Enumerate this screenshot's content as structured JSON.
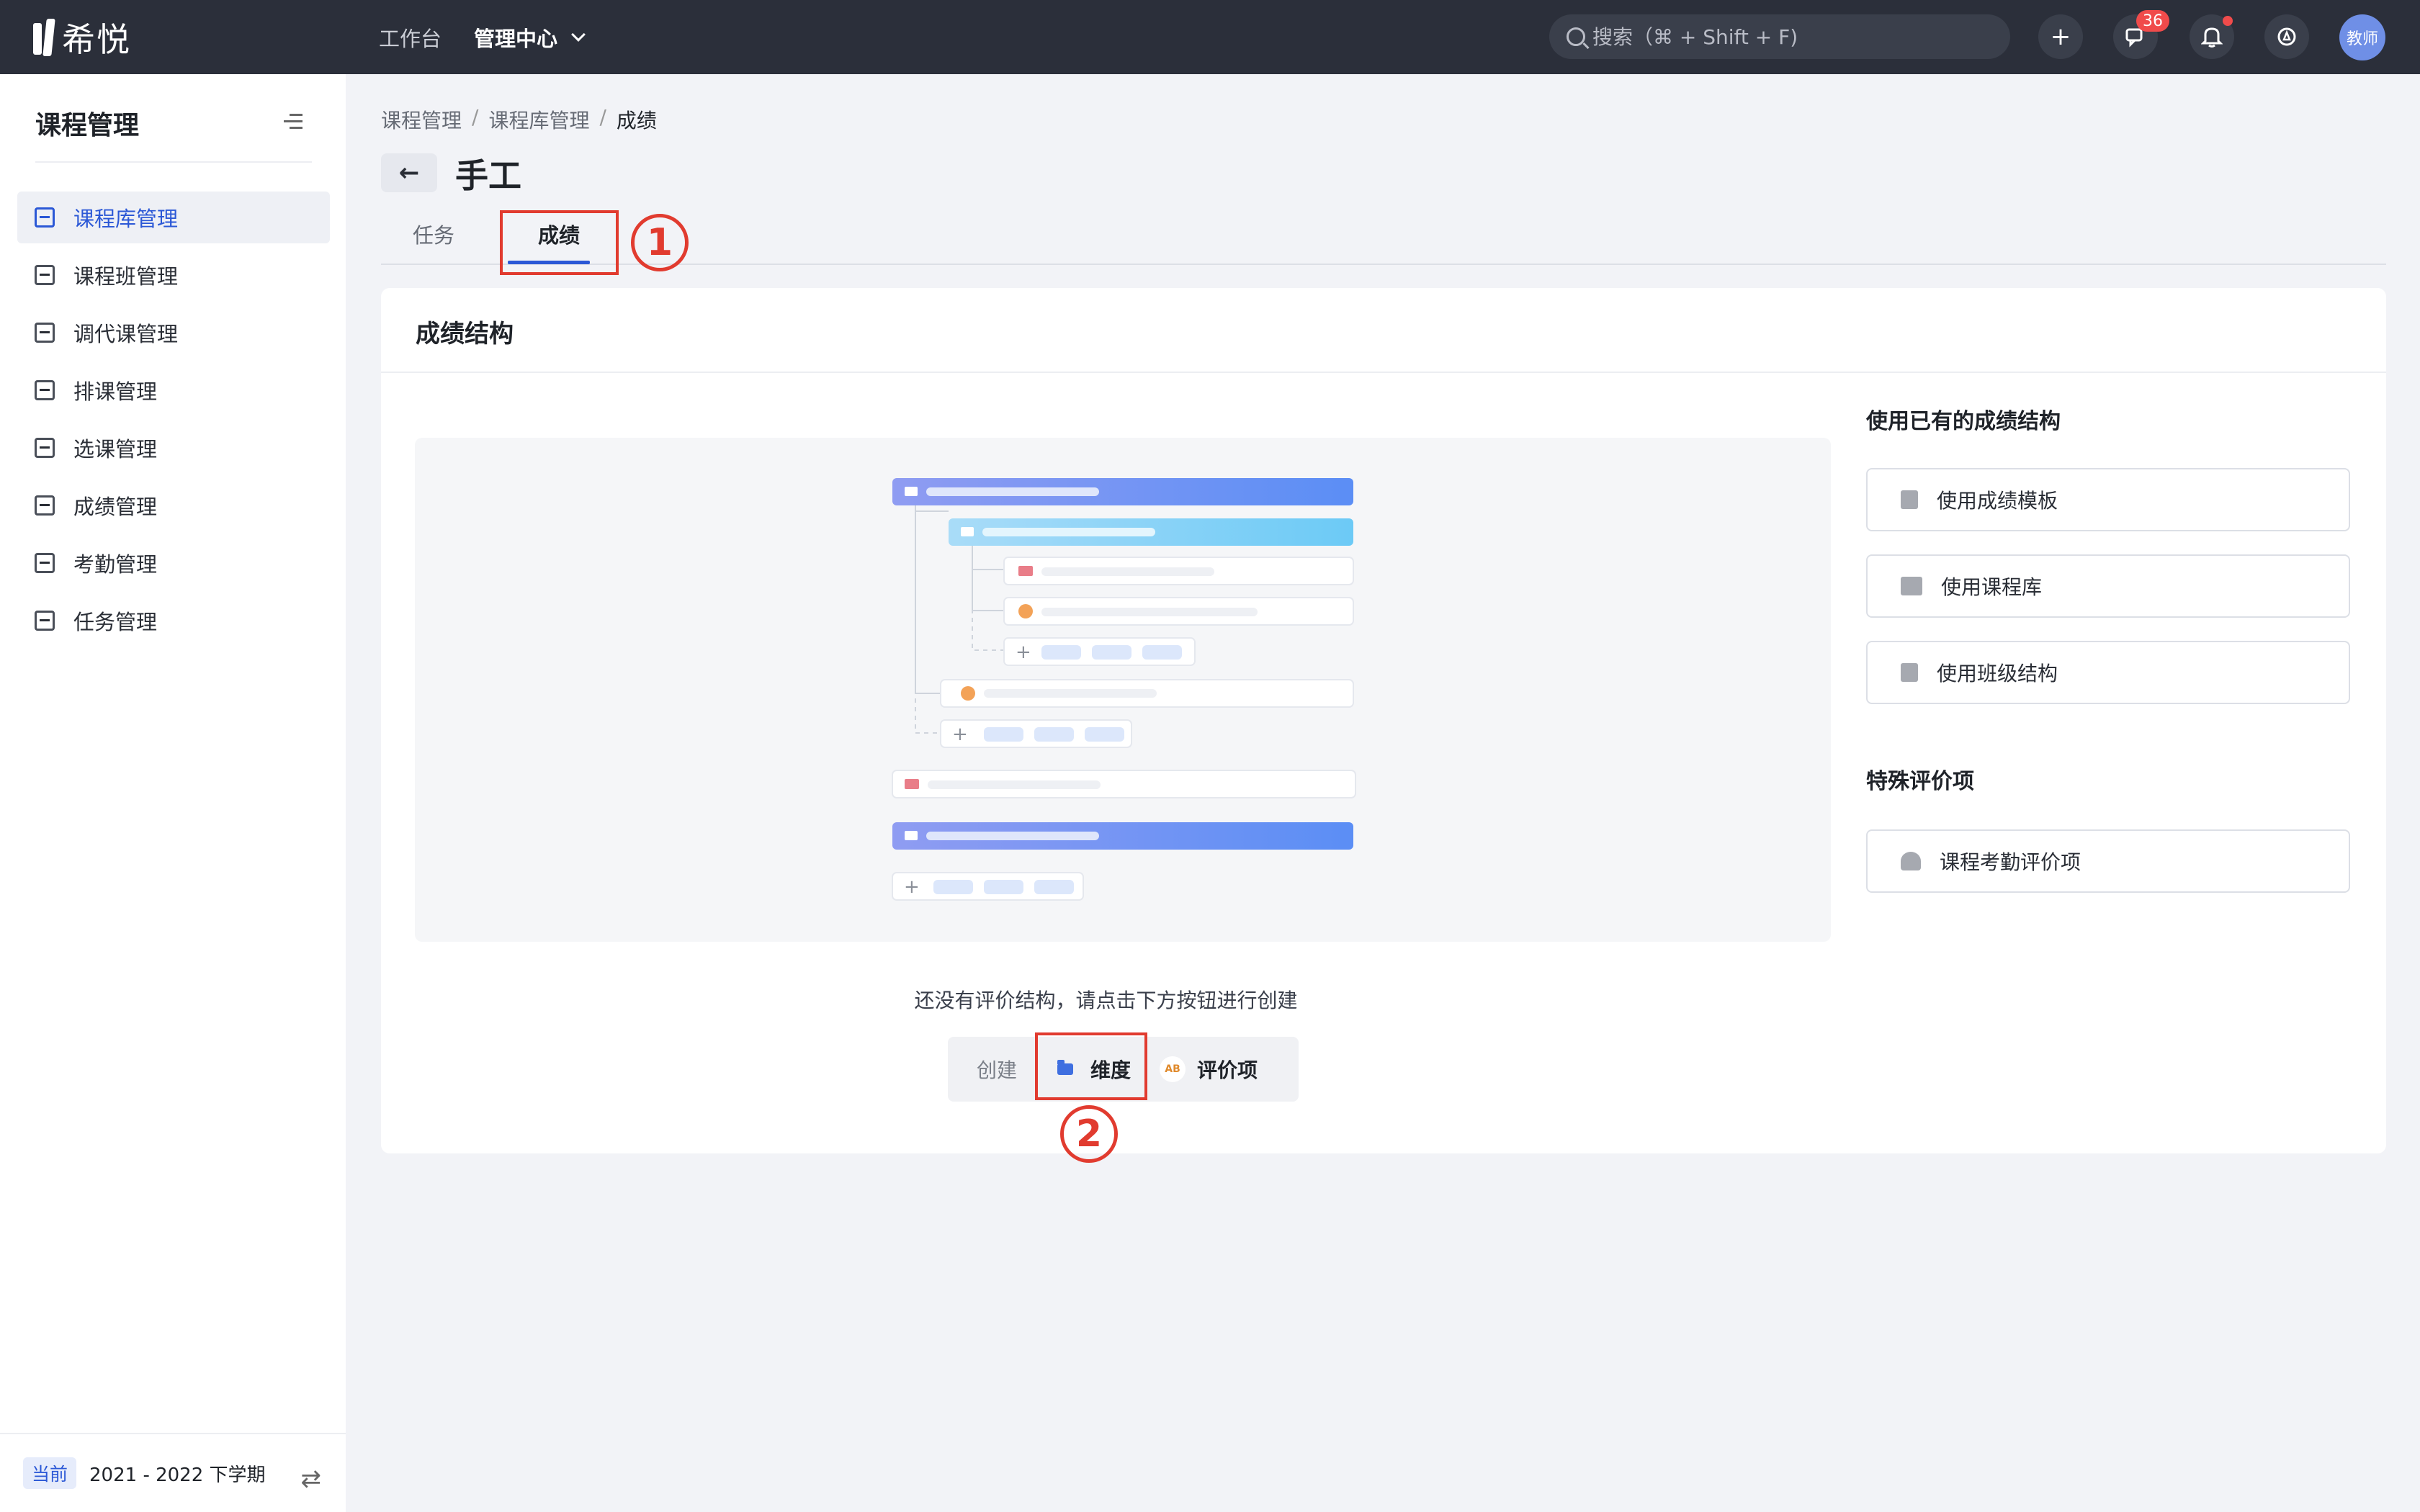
{
  "topbar": {
    "logo_text": "希悦",
    "nav_workbench": "工作台",
    "nav_admin": "管理中心",
    "search_placeholder": "搜索（⌘ + Shift + F)",
    "add_label": "+",
    "message_count": "36",
    "avatar_text": "教师"
  },
  "sidebar": {
    "title": "课程管理",
    "items": [
      {
        "label": "课程库管理",
        "active": true
      },
      {
        "label": "课程班管理"
      },
      {
        "label": "调代课管理"
      },
      {
        "label": "排课管理"
      },
      {
        "label": "选课管理"
      },
      {
        "label": "成绩管理"
      },
      {
        "label": "考勤管理"
      },
      {
        "label": "任务管理"
      }
    ],
    "term_tag": "当前",
    "term_text": "2021 - 2022 下学期",
    "swap_glyph": "⇄"
  },
  "breadcrumb": {
    "items": [
      "课程管理",
      "课程库管理",
      "成绩"
    ],
    "sep": "/"
  },
  "page": {
    "back_glyph": "←",
    "title": "手工",
    "tabs": [
      "任务",
      "成绩"
    ],
    "annotation_1": "1",
    "annotation_2": "2"
  },
  "card": {
    "title": "成绩结构",
    "empty_text": "还没有评价结构，请点击下方按钮进行创建",
    "create_label": "创建",
    "create_dimension": "维度",
    "create_item": "评价项",
    "ab_glyph": "AB"
  },
  "side": {
    "existing_title": "使用已有的成绩结构",
    "buttons": [
      "使用成绩模板",
      "使用课程库",
      "使用班级结构"
    ],
    "special_title": "特殊评价项",
    "special_buttons": [
      "课程考勤评价项"
    ]
  },
  "colors": {
    "accent": "#2b58d6",
    "topbar": "#2b2f3a",
    "annotation": "#e13b2f",
    "badge": "#f04b4b"
  }
}
